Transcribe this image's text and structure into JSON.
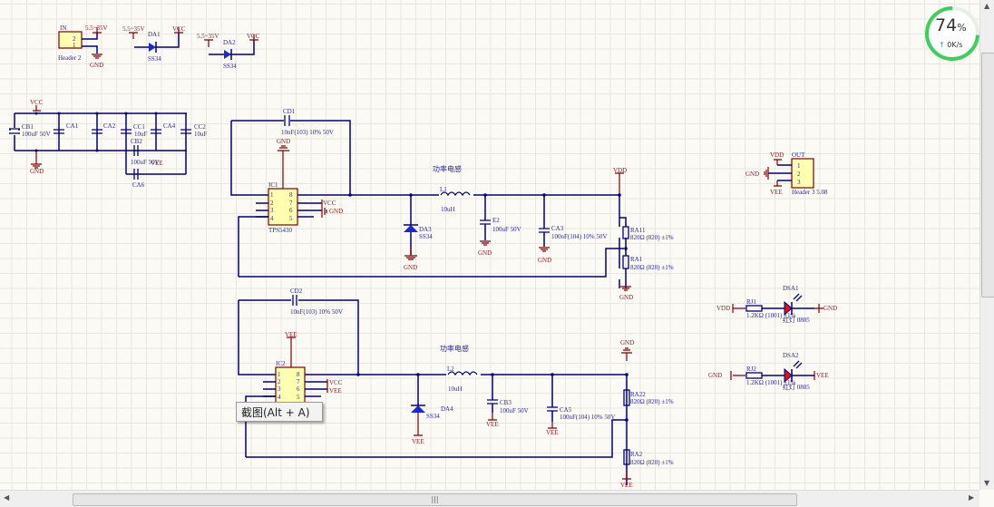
{
  "schematic": {
    "in_header": {
      "ref": "IN",
      "name": "Header 2",
      "pin2": "2",
      "pin1": "1",
      "net_in": "5.5~35V",
      "gnd": "GND"
    },
    "da1": {
      "ref": "DA1",
      "part": "SS34",
      "net_in": "5.5~35V",
      "net_out": "VCC"
    },
    "da2": {
      "ref": "DA2",
      "part": "SS34",
      "net_in": "5.5~35V",
      "net_out": "VCC"
    },
    "cap_bank": {
      "vcc": "VCC",
      "gnd": "GND",
      "vee": "VEE",
      "cb1": "CB1",
      "cb1_val": "100uF 50V",
      "ca1": "CA1",
      "ca2": "CA2",
      "cc1": "CC1",
      "cc1_val": "10uF",
      "ca4": "CA4",
      "cc2": "CC2",
      "cc2_val": "10uF",
      "cb2": "CB2",
      "cb2_val": "100uF 50V",
      "ca6": "CA6"
    },
    "pos_reg": {
      "cd1": "CD1",
      "cd1_val": "10nF(103) 10% 50V",
      "gnd_top": "GND",
      "ic": "IC1",
      "ic_part": "TPS5430",
      "pins": [
        "1",
        "2",
        "3",
        "4",
        "8",
        "7",
        "6",
        "5"
      ],
      "vcc": "VCC",
      "gnd_side": "GND",
      "inductor_note": "功率电感",
      "l": "L1",
      "l_val": "10uH",
      "d": "DA3",
      "d_part": "SS34",
      "d_gnd": "GND",
      "e": "E2",
      "e_val": "100uF 50V",
      "e_gnd": "GND",
      "ca": "CA3",
      "ca_val": "100nF(104) 10% 50V",
      "ca_gnd": "GND",
      "vdd": "VDD",
      "r1": "RA11",
      "r1_val": "820Ω (820) ±1%",
      "r2": "RA1",
      "r2_val": "820Ω (820) ±1%",
      "r_gnd": "GND"
    },
    "neg_reg": {
      "cd2": "CD2",
      "cd2_val": "10nF(103) 10% 50V",
      "vee_top": "VEE",
      "ic": "IC2",
      "pins": [
        "1",
        "2",
        "3",
        "4",
        "8",
        "7",
        "6",
        "5"
      ],
      "vcc": "VCC",
      "vee_side": "VEE",
      "inductor_note": "功率电感",
      "l": "L2",
      "l_val": "10uH",
      "d": "DA4",
      "d_part": "SS34",
      "d_vee": "VEE",
      "cb": "CB3",
      "cb_val": "100uF 50V",
      "cb_vee": "VEE",
      "ca": "CA5",
      "ca_val": "100nF(104) 10% 50V",
      "ca_vee": "VEE",
      "gnd": "GND",
      "r1": "RA22",
      "r1_val": "820Ω (820) ±1%",
      "r2": "RA2",
      "r2_val": "820Ω (820) ±1%",
      "r_vee": "VEE"
    },
    "out_header": {
      "ref": "OUT",
      "name": "Header 3 5.08",
      "vdd": "VDD",
      "gnd": "GND",
      "vee": "VEE",
      "pins": [
        "1",
        "2",
        "3"
      ]
    },
    "led1": {
      "left": "VDD",
      "r": "RJ1",
      "r_val": "1.2KΩ (1001) ±1%",
      "led": "DSA1",
      "led_val": "红灯 0805",
      "right": "GND"
    },
    "led2": {
      "left": "GND",
      "r": "RJ2",
      "r_val": "1.2KΩ (1001) ±1%",
      "led": "DSA2",
      "led_val": "红灯 0805",
      "right": "VEE"
    }
  },
  "gauge": {
    "percent": "74",
    "unit": "%",
    "speed": "0K/s",
    "fill": 0.74,
    "color": "#3ccf5a"
  },
  "tooltip": {
    "text": "截图(Alt + A)"
  },
  "scrollbars": {
    "grip": "|||"
  },
  "colors": {
    "wire": "#000080",
    "power": "#800000",
    "component_fill": "#ffffb0",
    "led": "#e01010"
  }
}
